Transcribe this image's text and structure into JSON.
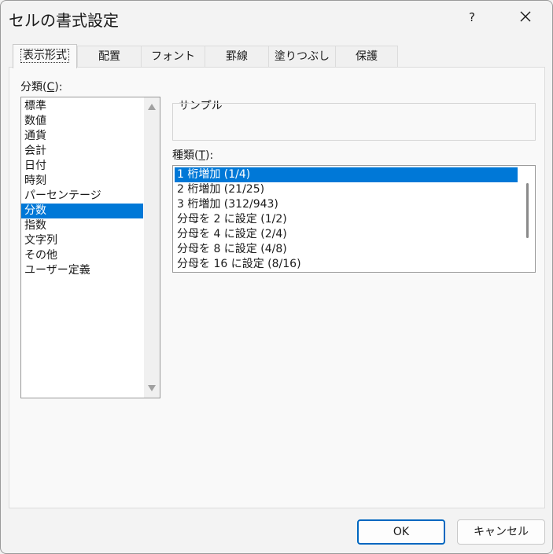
{
  "window": {
    "title": "セルの書式設定",
    "help_label": "?"
  },
  "tabs": [
    {
      "label": "表示形式"
    },
    {
      "label": "配置"
    },
    {
      "label": "フォント"
    },
    {
      "label": "罫線"
    },
    {
      "label": "塗りつぶし"
    },
    {
      "label": "保護"
    }
  ],
  "category": {
    "label": "分類",
    "mnemonic": "C",
    "items": [
      "標準",
      "数値",
      "通貨",
      "会計",
      "日付",
      "時刻",
      "パーセンテージ",
      "分数",
      "指数",
      "文字列",
      "その他",
      "ユーザー定義"
    ],
    "selected": "分数"
  },
  "sample": {
    "label": "サンプル"
  },
  "type": {
    "label": "種類",
    "mnemonic": "T",
    "items": [
      "1 桁増加 (1/4)",
      "2 桁増加 (21/25)",
      "3 桁増加 (312/943)",
      "分母を 2 に設定 (1/2)",
      "分母を 4 に設定 (2/4)",
      "分母を 8 に設定 (4/8)",
      "分母を 16 に設定 (8/16)"
    ],
    "selected": "1 桁増加 (1/4)"
  },
  "buttons": {
    "ok": "OK",
    "cancel": "キャンセル"
  },
  "colors": {
    "selection": "#0078d7",
    "ok_border": "#0067c0"
  }
}
